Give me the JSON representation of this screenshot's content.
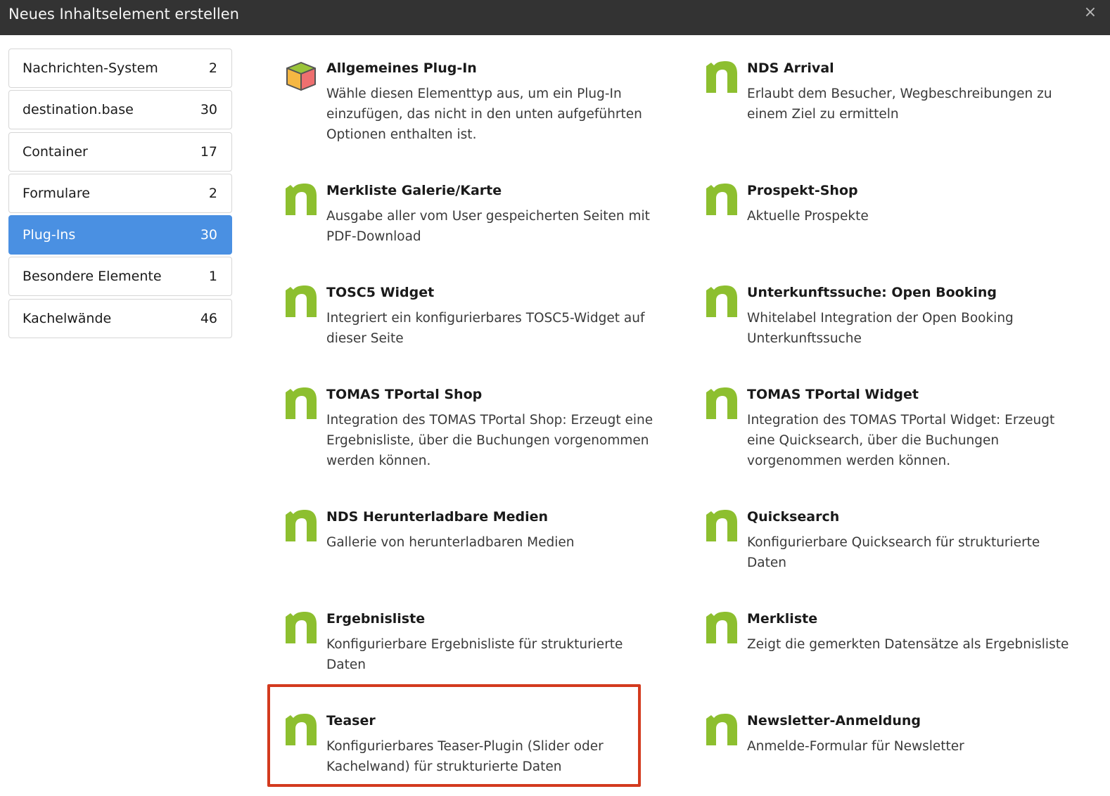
{
  "dialog": {
    "title": "Neues Inhaltselement erstellen",
    "close_glyph": "×"
  },
  "categories": [
    {
      "label": "Nachrichten-System",
      "count": "2",
      "active": false
    },
    {
      "label": "destination.base",
      "count": "30",
      "active": false
    },
    {
      "label": "Container",
      "count": "17",
      "active": false
    },
    {
      "label": "Formulare",
      "count": "2",
      "active": false
    },
    {
      "label": "Plug-Ins",
      "count": "30",
      "active": true
    },
    {
      "label": "Besondere Elemente",
      "count": "1",
      "active": false
    },
    {
      "label": "Kachelwände",
      "count": "46",
      "active": false
    }
  ],
  "items": [
    {
      "icon": "cube-icon",
      "name": "Allgemeines Plug-In",
      "desc": "Wähle diesen Elementtyp aus, um ein Plug-In einzufügen, das nicht in den unten aufgeführten Optionen enthalten ist."
    },
    {
      "icon": "n-logo-icon",
      "name": "NDS Arrival",
      "desc": "Erlaubt dem Besucher, Wegbeschreibungen zu einem Ziel zu ermitteln"
    },
    {
      "icon": "n-logo-icon",
      "name": "Merkliste Galerie/Karte",
      "desc": "Ausgabe aller vom User gespeicherten Seiten mit PDF-Download"
    },
    {
      "icon": "n-logo-icon",
      "name": "Prospekt-Shop",
      "desc": "Aktuelle Prospekte"
    },
    {
      "icon": "n-logo-icon",
      "name": "TOSC5 Widget",
      "desc": "Integriert ein konfigurierbares TOSC5-Widget auf dieser Seite"
    },
    {
      "icon": "n-logo-icon",
      "name": "Unterkunftssuche: Open Booking",
      "desc": "Whitelabel Integration der Open Booking Unterkunftssuche"
    },
    {
      "icon": "n-logo-icon",
      "name": "TOMAS TPortal Shop",
      "desc": "Integration des TOMAS TPortal Shop: Erzeugt eine Ergebnisliste, über die Buchungen vorgenommen werden können."
    },
    {
      "icon": "n-logo-icon",
      "name": "TOMAS TPortal Widget",
      "desc": "Integration des TOMAS TPortal Widget: Erzeugt eine Quicksearch, über die Buchungen vorgenommen werden können."
    },
    {
      "icon": "n-logo-icon",
      "name": "NDS Herunterladbare Medien",
      "desc": "Gallerie von herunterladbaren Medien"
    },
    {
      "icon": "n-logo-icon",
      "name": "Quicksearch",
      "desc": "Konfigurierbare Quicksearch für strukturierte Daten"
    },
    {
      "icon": "n-logo-icon",
      "name": "Ergebnisliste",
      "desc": "Konfigurierbare Ergebnisliste für strukturierte Daten"
    },
    {
      "icon": "n-logo-icon",
      "name": "Merkliste",
      "desc": "Zeigt die gemerkten Datensätze als Ergebnisliste"
    },
    {
      "icon": "n-logo-icon",
      "name": "Teaser",
      "desc": "Konfigurierbares Teaser-Plugin (Slider oder Kachelwand) für strukturierte Daten"
    },
    {
      "icon": "n-logo-icon",
      "name": "Newsletter-Anmeldung",
      "desc": "Anmelde-Formular für Newsletter"
    }
  ],
  "colors": {
    "titlebar": "#333333",
    "active_category": "#4a90e2",
    "n_logo_green": "#8dbf2f",
    "highlight_border": "#d33a1e"
  }
}
